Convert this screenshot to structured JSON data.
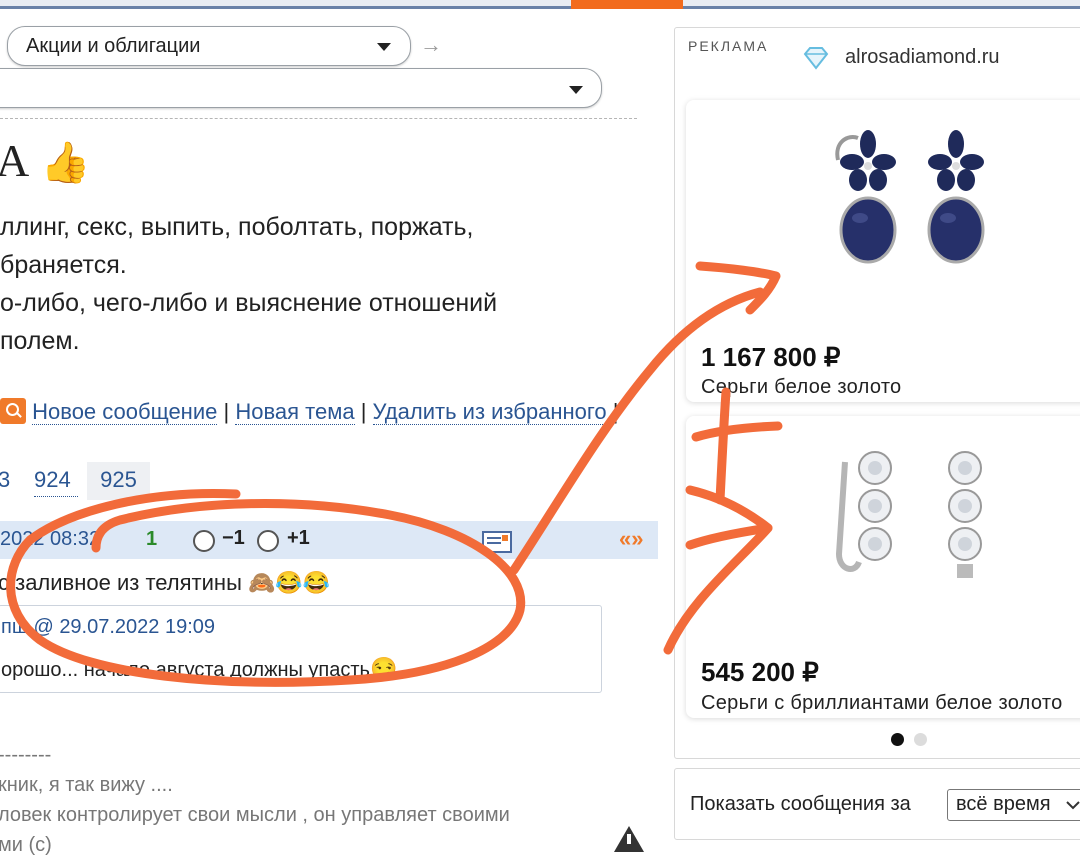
{
  "forum": {
    "category_select": "Акции и облигации",
    "title_fragment": "А",
    "title_emoji": "👍",
    "rules": [
      "ллинг, секс, выпить, поболтать, поржать,",
      "браняется.",
      "о-либо, чего-либо и выяснение отношений",
      "полем."
    ],
    "actions": {
      "new_message": "Новое сообщение",
      "new_topic": "Новая тема",
      "remove_favorite": "Удалить из избранного",
      "separator": "|"
    },
    "pagination": [
      "3",
      "924",
      "925"
    ],
    "message": {
      "datetime": "2022 08:32",
      "rating": "1",
      "vote_minus": "−1",
      "vote_plus": "+1",
      "reply_glyph": "«»",
      "text": "с заливное из телятины",
      "emojis": "🙈😂😂",
      "quote_author": "пш",
      "quote_at": "@",
      "quote_date": "29.07.2022 19:09",
      "quote_text": "орошо... начало августа должны упасть",
      "quote_emoji": "😏"
    },
    "signature": {
      "divider": "--------",
      "line1": "кник, я так вижу ....",
      "line2": "ловек контролирует свои мысли , он управляет своими",
      "line3": "ми (с)"
    }
  },
  "ad": {
    "label": "РЕКЛАМА",
    "domain": "alrosadiamond.ru",
    "products": [
      {
        "price": "1 167 800 ₽",
        "name": "Серьги белое золото"
      },
      {
        "price": "545 200 ₽",
        "name": "Серьги с бриллиантами белое золото"
      }
    ],
    "carousel_active": 1,
    "carousel_total": 2
  },
  "filter": {
    "label": "Показать сообщения за",
    "value": "всё время"
  },
  "colors": {
    "link": "#2a5592",
    "accent": "#f26b1d",
    "header_bg": "#dde8f6",
    "annotation": "#f26b3a"
  }
}
